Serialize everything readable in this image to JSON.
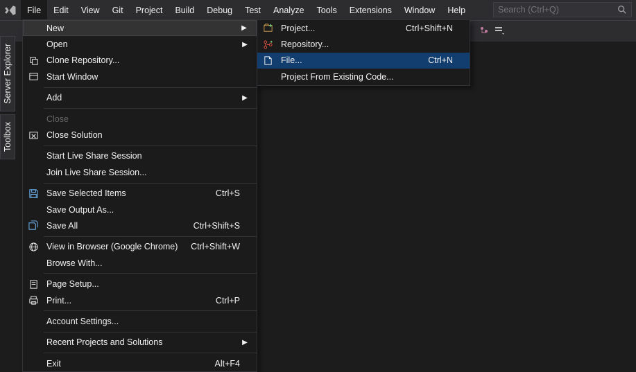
{
  "menu_bar": {
    "items": [
      "File",
      "Edit",
      "View",
      "Git",
      "Project",
      "Build",
      "Debug",
      "Test",
      "Analyze",
      "Tools",
      "Extensions",
      "Window",
      "Help"
    ],
    "open_index": 0,
    "search_placeholder": "Search (Ctrl+Q)"
  },
  "side_tabs": [
    "Server Explorer",
    "Toolbox"
  ],
  "file_menu": {
    "items": [
      {
        "icon": "",
        "label": "New",
        "shortcut": "",
        "arrow": true,
        "highlight": true
      },
      {
        "icon": "",
        "label": "Open",
        "shortcut": "",
        "arrow": true
      },
      {
        "icon": "clone",
        "label": "Clone Repository...",
        "shortcut": ""
      },
      {
        "icon": "window",
        "label": "Start Window",
        "shortcut": ""
      },
      {
        "sep": true
      },
      {
        "icon": "",
        "label": "Add",
        "shortcut": "",
        "arrow": true
      },
      {
        "sep": true
      },
      {
        "icon": "",
        "label": "Close",
        "shortcut": "",
        "disabled": true
      },
      {
        "icon": "close-sol",
        "label": "Close Solution",
        "shortcut": ""
      },
      {
        "sep": true
      },
      {
        "icon": "",
        "label": "Start Live Share Session",
        "shortcut": ""
      },
      {
        "icon": "",
        "label": "Join Live Share Session...",
        "shortcut": ""
      },
      {
        "sep": true
      },
      {
        "icon": "save",
        "label": "Save Selected Items",
        "shortcut": "Ctrl+S"
      },
      {
        "icon": "",
        "label": "Save Output As...",
        "shortcut": ""
      },
      {
        "icon": "save-all",
        "label": "Save All",
        "shortcut": "Ctrl+Shift+S"
      },
      {
        "sep": true
      },
      {
        "icon": "browser",
        "label": "View in Browser (Google Chrome)",
        "shortcut": "Ctrl+Shift+W"
      },
      {
        "icon": "",
        "label": "Browse With...",
        "shortcut": ""
      },
      {
        "sep": true
      },
      {
        "icon": "page",
        "label": "Page Setup...",
        "shortcut": ""
      },
      {
        "icon": "print",
        "label": "Print...",
        "shortcut": "Ctrl+P"
      },
      {
        "sep": true
      },
      {
        "icon": "",
        "label": "Account Settings...",
        "shortcut": ""
      },
      {
        "sep": true
      },
      {
        "icon": "",
        "label": "Recent Projects and Solutions",
        "shortcut": "",
        "arrow": true
      },
      {
        "sep": true
      },
      {
        "icon": "",
        "label": "Exit",
        "shortcut": "Alt+F4"
      }
    ]
  },
  "new_submenu": {
    "items": [
      {
        "icon": "project",
        "label": "Project...",
        "shortcut": "Ctrl+Shift+N"
      },
      {
        "icon": "repo",
        "label": "Repository...",
        "shortcut": ""
      },
      {
        "icon": "file",
        "label": "File...",
        "shortcut": "Ctrl+N",
        "highlight": true
      },
      {
        "icon": "",
        "label": "Project From Existing Code...",
        "shortcut": ""
      }
    ]
  }
}
